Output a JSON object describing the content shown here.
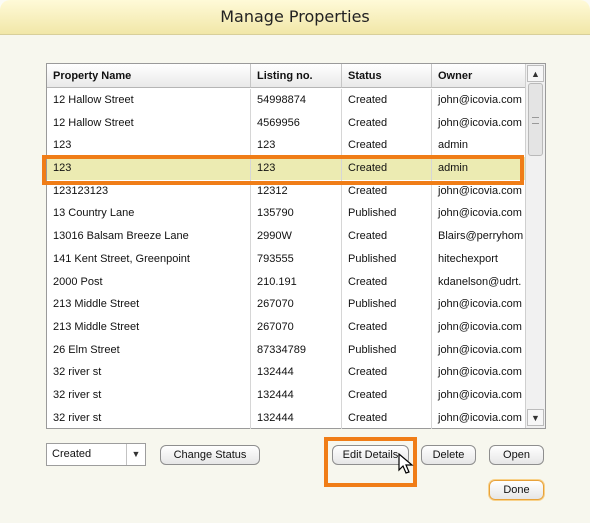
{
  "window": {
    "title": "Manage Properties"
  },
  "table": {
    "columns": [
      "Property Name",
      "Listing no.",
      "Status",
      "Owner"
    ],
    "rows": [
      [
        "12 Hallow Street",
        "54998874",
        "Created",
        "john@icovia.com"
      ],
      [
        "12 Hallow Street",
        "4569956",
        "Created",
        "john@icovia.com"
      ],
      [
        "123",
        "123",
        "Created",
        "admin"
      ],
      [
        "123",
        "123",
        "Created",
        "admin"
      ],
      [
        "123123123",
        "12312",
        "Created",
        "john@icovia.com"
      ],
      [
        "13 Country Lane",
        "135790",
        "Published",
        "john@icovia.com"
      ],
      [
        "13016 Balsam Breeze Lane",
        "2990W",
        "Created",
        "Blairs@perryhom"
      ],
      [
        "141 Kent Street, Greenpoint",
        "793555",
        "Published",
        "hitechexport"
      ],
      [
        "2000 Post",
        "210.191",
        "Created",
        "kdanelson@udrt."
      ],
      [
        "213 Middle Street",
        "267070",
        "Published",
        "john@icovia.com"
      ],
      [
        "213 Middle Street",
        "267070",
        "Created",
        "john@icovia.com"
      ],
      [
        "26 Elm Street",
        "87334789",
        "Published",
        "john@icovia.com"
      ],
      [
        "32 river st",
        "132444",
        "Created",
        "john@icovia.com"
      ],
      [
        "32 river st",
        "132444",
        "Created",
        "john@icovia.com"
      ],
      [
        "32 river st",
        "132444",
        "Created",
        "john@icovia.com"
      ]
    ],
    "selected_row_index": 3
  },
  "status_select": {
    "value": "Created"
  },
  "buttons": {
    "change_status": "Change Status",
    "edit_details": "Edit Details",
    "delete": "Delete",
    "open": "Open",
    "done": "Done"
  },
  "colors": {
    "highlight": "#f07d17",
    "selected_row": "#ecebb2",
    "title_bar": "#f1e7a8"
  },
  "icons": {
    "scroll_up": "up-arrow-icon",
    "scroll_down": "down-arrow-icon",
    "dropdown": "chevron-down-icon",
    "cursor": "pointer-cursor-icon"
  }
}
